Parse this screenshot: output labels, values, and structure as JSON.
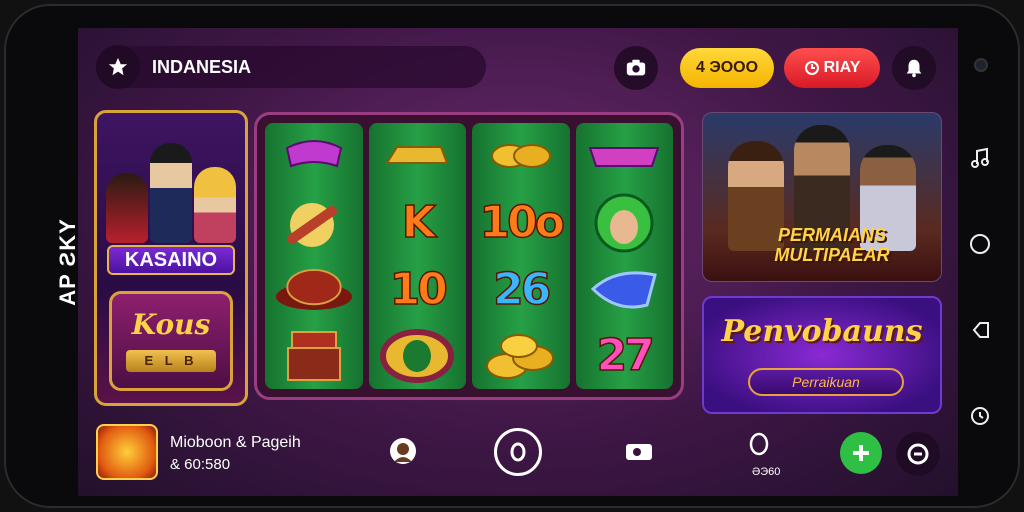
{
  "device": {
    "side_label": "AP ƧKY"
  },
  "topbar": {
    "region": "INDANESIA",
    "coins": "4 ЭООО",
    "play_label": "RIAY"
  },
  "casino_card": {
    "title": "KASAINO",
    "subtitle": "Kous",
    "ribbon": "E L B"
  },
  "slot": {
    "reels": [
      [
        "candy",
        "cannon",
        "hat",
        "chest"
      ],
      [
        "gold-bar",
        "K",
        "10",
        "ring"
      ],
      [
        "coins",
        "10o",
        "26",
        "coins"
      ],
      [
        "banner",
        "face",
        "gem",
        "27"
      ]
    ]
  },
  "multi_card": {
    "title_line1": "PERMAIANS",
    "title_line2": "MULTIPAEAR"
  },
  "promo_card": {
    "title": "Penvobauns",
    "subtitle": "Perraikuan"
  },
  "bottombar": {
    "game_name": "Mioboon & Pageih",
    "game_score": "& 60:580",
    "nav_score": "ƏЭ60"
  },
  "colors": {
    "coins_bg": "#f4b400",
    "play_bg": "#d81a26",
    "add_bg": "#2fbf45",
    "frame_gold": "#d9a33a"
  }
}
